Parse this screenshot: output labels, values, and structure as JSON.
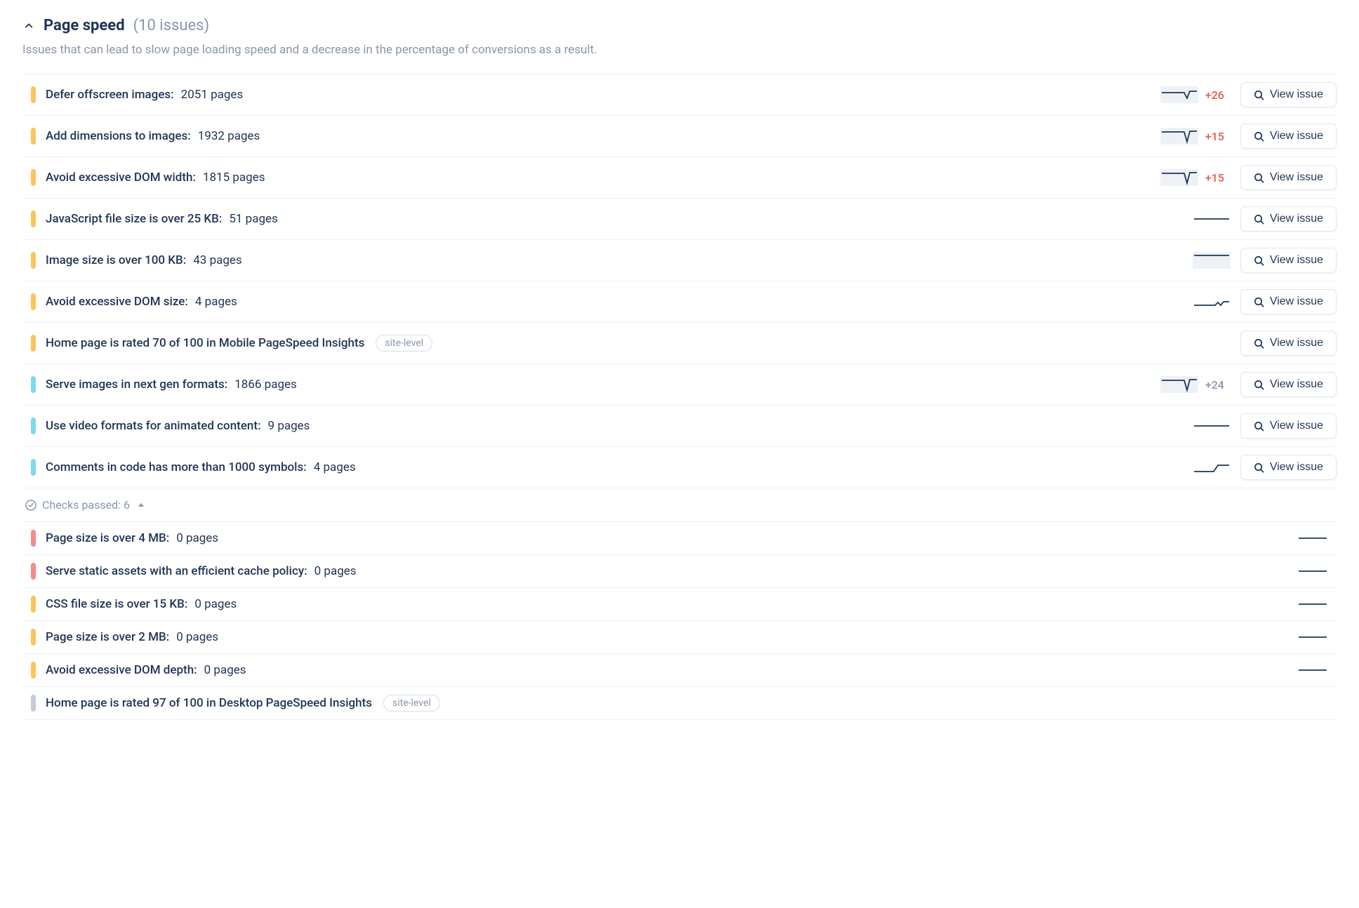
{
  "section": {
    "title": "Page speed",
    "count_label": "(10 issues)",
    "description": "Issues that can lead to slow page loading speed and a decrease in the percentage of conversions as a result."
  },
  "view_label": "View issue",
  "site_level_label": "site-level",
  "checks_passed_label": "Checks passed: 6",
  "issues": [
    {
      "pill": "yellow",
      "title": "Defer offscreen images",
      "pages": "2051 pages",
      "spark": "dip",
      "delta": "+26",
      "delta_color": "red",
      "has_view": true
    },
    {
      "pill": "yellow",
      "title": "Add dimensions to images",
      "pages": "1932 pages",
      "spark": "dip-deep",
      "delta": "+15",
      "delta_color": "red",
      "has_view": true
    },
    {
      "pill": "yellow",
      "title": "Avoid excessive DOM width",
      "pages": "1815 pages",
      "spark": "dip-deep",
      "delta": "+15",
      "delta_color": "red",
      "has_view": true
    },
    {
      "pill": "yellow",
      "title": "JavaScript file size is over 25 KB",
      "pages": "51 pages",
      "spark": "flat",
      "delta": "",
      "delta_color": "",
      "has_view": true
    },
    {
      "pill": "yellow",
      "title": "Image size is over 100 KB",
      "pages": "43 pages",
      "spark": "flat-top",
      "delta": "",
      "delta_color": "",
      "has_view": true
    },
    {
      "pill": "yellow",
      "title": "Avoid excessive DOM size",
      "pages": "4 pages",
      "spark": "wavy",
      "delta": "",
      "delta_color": "",
      "has_view": true
    },
    {
      "pill": "yellow",
      "title": "Home page is rated 70 of 100 in Mobile PageSpeed Insights",
      "pages": "",
      "site_level": true,
      "spark": "",
      "delta": "",
      "delta_color": "",
      "has_view": true,
      "nocolon": true
    },
    {
      "pill": "blue",
      "title": "Serve images in next gen formats",
      "pages": "1866 pages",
      "spark": "dip-deep",
      "delta": "+24",
      "delta_color": "grey",
      "has_view": true
    },
    {
      "pill": "blue",
      "title": "Use video formats for animated content",
      "pages": "9 pages",
      "spark": "flat",
      "delta": "",
      "delta_color": "",
      "has_view": true
    },
    {
      "pill": "blue",
      "title": "Comments in code has more than 1000 symbols",
      "pages": "4 pages",
      "spark": "step-up",
      "delta": "",
      "delta_color": "",
      "has_view": true
    }
  ],
  "passed": [
    {
      "pill": "red",
      "title": "Page size is over 4 MB",
      "pages": "0 pages",
      "spark": "flat"
    },
    {
      "pill": "red",
      "title": "Serve static assets with an efficient cache policy",
      "pages": "0 pages",
      "spark": "flat"
    },
    {
      "pill": "yellow",
      "title": "CSS file size is over 15 KB",
      "pages": "0 pages",
      "spark": "flat"
    },
    {
      "pill": "yellow",
      "title": "Page size is over 2 MB",
      "pages": "0 pages",
      "spark": "flat"
    },
    {
      "pill": "yellow",
      "title": "Avoid excessive DOM depth",
      "pages": "0 pages",
      "spark": "flat"
    },
    {
      "pill": "grey",
      "title": "Home page is rated 97 of 100 in Desktop PageSpeed Insights",
      "pages": "",
      "site_level": true,
      "spark": "",
      "nocolon": true
    }
  ]
}
